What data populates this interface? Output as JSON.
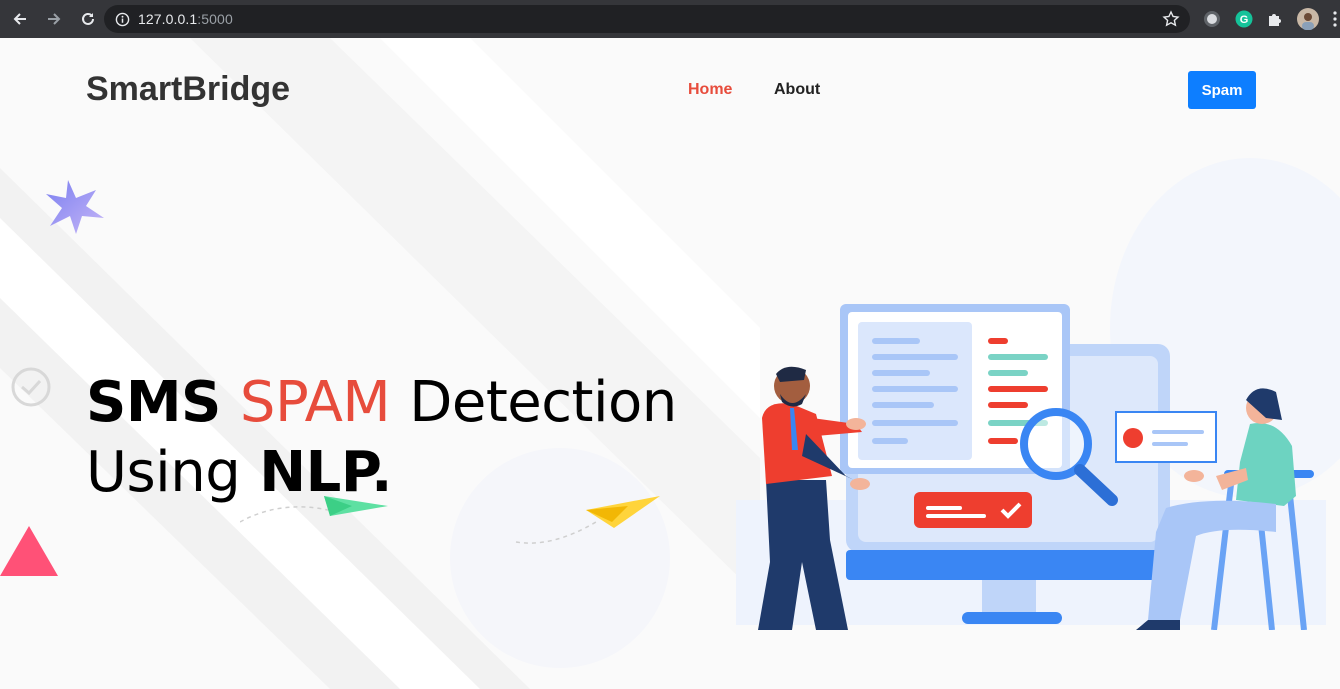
{
  "browser": {
    "url_host": "127.0.0.1",
    "url_port": ":5000"
  },
  "header": {
    "brand": "SmartBridge",
    "nav": [
      {
        "label": "Home",
        "active": true
      },
      {
        "label": "About",
        "active": false
      }
    ],
    "spam_button": "Spam"
  },
  "hero": {
    "title_part1": "SMS",
    "title_part2": "SPAM",
    "title_part3": "Detection",
    "title_part4": "Using",
    "title_part5": "NLP."
  },
  "colors": {
    "accent_red": "#e74c3c",
    "button_blue": "#0d7eff",
    "brand_text": "#333333"
  }
}
